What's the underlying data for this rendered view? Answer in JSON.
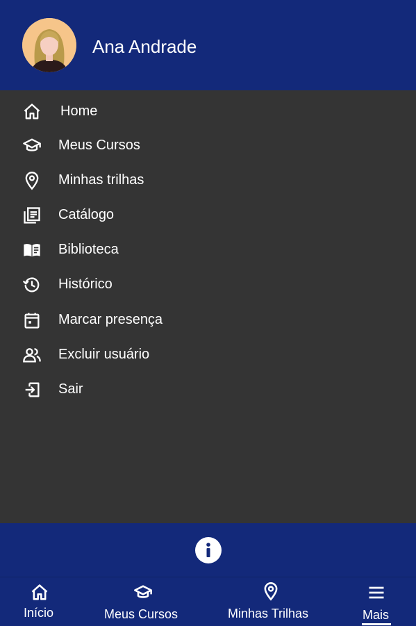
{
  "user": {
    "name": "Ana Andrade"
  },
  "menu": {
    "items": [
      {
        "label": "Home",
        "icon": "home-icon"
      },
      {
        "label": "Meus Cursos",
        "icon": "graduation-cap-icon"
      },
      {
        "label": "Minhas trilhas",
        "icon": "map-pin-icon"
      },
      {
        "label": "Catálogo",
        "icon": "catalog-icon"
      },
      {
        "label": "Biblioteca",
        "icon": "book-open-icon"
      },
      {
        "label": "Histórico",
        "icon": "history-icon"
      },
      {
        "label": "Marcar presença",
        "icon": "calendar-icon"
      },
      {
        "label": "Excluir usuário",
        "icon": "users-icon"
      },
      {
        "label": "Sair",
        "icon": "logout-icon"
      }
    ]
  },
  "info": {
    "icon": "info-icon"
  },
  "bottom_nav": {
    "items": [
      {
        "label": "Início",
        "icon": "home-icon"
      },
      {
        "label": "Meus Cursos",
        "icon": "graduation-cap-icon"
      },
      {
        "label": "Minhas Trilhas",
        "icon": "map-pin-icon"
      },
      {
        "label": "Mais",
        "icon": "menu-icon",
        "active": true
      }
    ]
  },
  "colors": {
    "header_bg": "#13297a",
    "menu_bg": "#343434",
    "text": "#ffffff"
  }
}
